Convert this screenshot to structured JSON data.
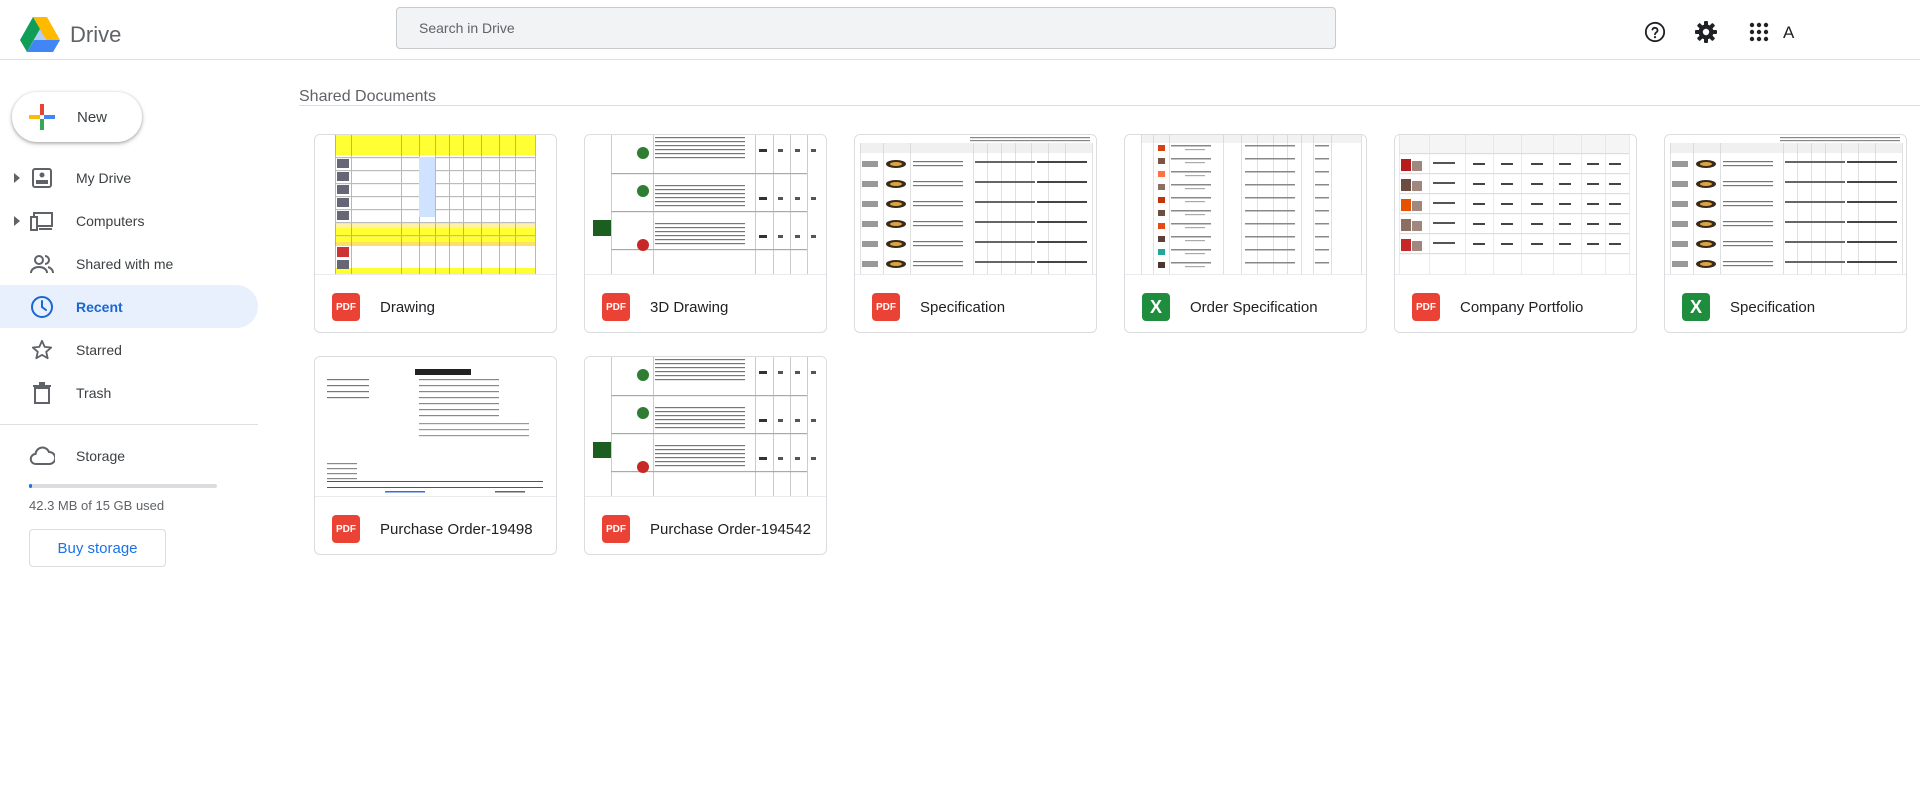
{
  "header": {
    "app_title": "Drive",
    "search_placeholder": "Search in Drive",
    "avatar_letter": "A",
    "icons": [
      "help-icon",
      "settings-icon",
      "apps-grid-icon"
    ]
  },
  "sidebar": {
    "new_label": "New",
    "items": [
      {
        "label": "My Drive",
        "icon": "my-drive-icon",
        "expandable": true,
        "active": false
      },
      {
        "label": "Computers",
        "icon": "computers-icon",
        "expandable": true,
        "active": false
      },
      {
        "label": "Shared with me",
        "icon": "shared-people-icon",
        "expandable": false,
        "active": false
      },
      {
        "label": "Recent",
        "icon": "clock-icon",
        "expandable": false,
        "active": true
      },
      {
        "label": "Starred",
        "icon": "star-icon",
        "expandable": false,
        "active": false
      },
      {
        "label": "Trash",
        "icon": "trash-icon",
        "expandable": false,
        "active": false
      },
      {
        "label": "Storage",
        "icon": "cloud-icon",
        "expandable": false,
        "active": false
      }
    ],
    "storage_text": "42.3 MB of 15 GB used",
    "storage_fraction": 0.003,
    "buy_storage_label": "Buy storage"
  },
  "main": {
    "section_title": "Shared Documents",
    "files": [
      {
        "name": "Drawing",
        "type": "pdf",
        "type_label": "PDF",
        "preview": "yellow-table"
      },
      {
        "name": "3D Drawing",
        "type": "pdf",
        "type_label": "PDF",
        "preview": "product-list"
      },
      {
        "name": "Specification",
        "type": "pdf",
        "type_label": "PDF",
        "preview": "spec-table"
      },
      {
        "name": "Order Specification",
        "type": "xls",
        "type_label": "X",
        "preview": "order-table"
      },
      {
        "name": "Company Portfolio",
        "type": "pdf",
        "type_label": "PDF",
        "preview": "portfolio-table"
      },
      {
        "name": "Specification",
        "type": "xls",
        "type_label": "X",
        "preview": "spec-table"
      },
      {
        "name": "Purchase Order-19498",
        "type": "pdf",
        "type_label": "PDF",
        "preview": "purchase-order"
      },
      {
        "name": "Purchase Order-194542",
        "type": "pdf",
        "type_label": "PDF",
        "preview": "product-list"
      }
    ]
  },
  "colors": {
    "accent": "#1a73e8",
    "active_bg": "#e8f0fe",
    "pdf_red": "#ea4335",
    "sheet_green": "#1e8e3e",
    "thumb_yellow": "#ffff33"
  }
}
